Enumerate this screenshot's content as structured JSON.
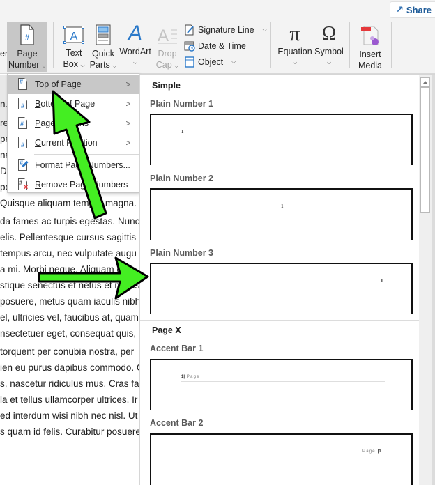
{
  "ribbon": {
    "share_label": "Share",
    "cut_left_label": "er",
    "page_number": {
      "line1": "Page",
      "line2": "Number"
    },
    "text_box": {
      "line1": "Text",
      "line2": "Box"
    },
    "quick_parts": {
      "line1": "Quick",
      "line2": "Parts"
    },
    "wordart": {
      "line1": "WordArt"
    },
    "drop_cap": {
      "line1": "Drop",
      "line2": "Cap"
    },
    "signature_line": "Signature Line",
    "date_time": "Date & Time",
    "object": "Object",
    "equation": "Equation",
    "symbol": "Symbol",
    "insert_media": {
      "line1": "Insert",
      "line2": "Media"
    },
    "glyphs": {
      "equation": "π",
      "symbol": "Ω",
      "wordart": "A",
      "text_box": "A"
    }
  },
  "menu": {
    "items": [
      {
        "label_underline": "T",
        "label_rest": "op of Page",
        "icon": "page-top-icon",
        "submenu": true
      },
      {
        "label_underline": "B",
        "label_rest": "ottom of Page",
        "icon": "page-bottom-icon",
        "submenu": true
      },
      {
        "label_underline": "P",
        "label_rest": "age Margins",
        "icon": "page-margins-icon",
        "submenu": true
      },
      {
        "label_underline": "C",
        "label_rest": "urrent Position",
        "icon": "current-position-icon",
        "submenu": true
      },
      {
        "label_underline": "F",
        "label_rest": "ormat Page Numbers...",
        "icon": "format-page-numbers-icon",
        "submenu": false
      },
      {
        "label_underline": "R",
        "label_rest": "emove Page Numbers",
        "icon": "remove-page-numbers-icon",
        "submenu": false
      }
    ],
    "chevron": ">"
  },
  "document": {
    "lines": [
      "n.",
      "retium mattis, nunc. Mauris eget n",
      "pede. Suspendisse dapibus lorem",
      "nec hendrerit, felis et imperdiet eu",
      "Donec ut est in lectus consequat co",
      "porta tristique.",
      "Quisque aliquam tempor magna.",
      "da fames ac turpis egestas. Nunc a",
      "elis. Pellentesque cursus sagittis f",
      " tempus arcu, nec vulputate augu",
      " a mi. Morbi neque. Aliquam erat",
      "stique senectus et netus et males",
      "posuere, metus quam iaculis nibh,",
      "el, ultricies vel, faucibus at, quam.",
      "nsectetuer eget, consequat quis, t",
      " torquent per conubia nostra, per",
      "ien eu purus dapibus commodo. C",
      "s, nascetur ridiculus mus. Cras fau",
      " la et tellus ullamcorper ultrices. Ir",
      "ed interdum wisi nibh nec nisl. Ut",
      "s quam id felis. Curabitur posuere"
    ]
  },
  "gallery": {
    "sections": [
      {
        "heading": "Simple"
      },
      {
        "heading": "Page X"
      }
    ],
    "items": [
      {
        "title": "Plain Number 1",
        "sample": "1"
      },
      {
        "title": "Plain Number 2",
        "sample": "1"
      },
      {
        "title": "Plain Number 3",
        "sample": "1"
      },
      {
        "title": "Accent Bar 1",
        "sample_num": "1",
        "sample_sep": "|",
        "sample_word": "Page"
      },
      {
        "title": "Accent Bar 2",
        "sample_num": "1",
        "sample_sep": "|",
        "sample_word": "Page"
      }
    ]
  },
  "annotations": {
    "arrow_color": "#44ee22",
    "arrow_outline": "#000000"
  }
}
